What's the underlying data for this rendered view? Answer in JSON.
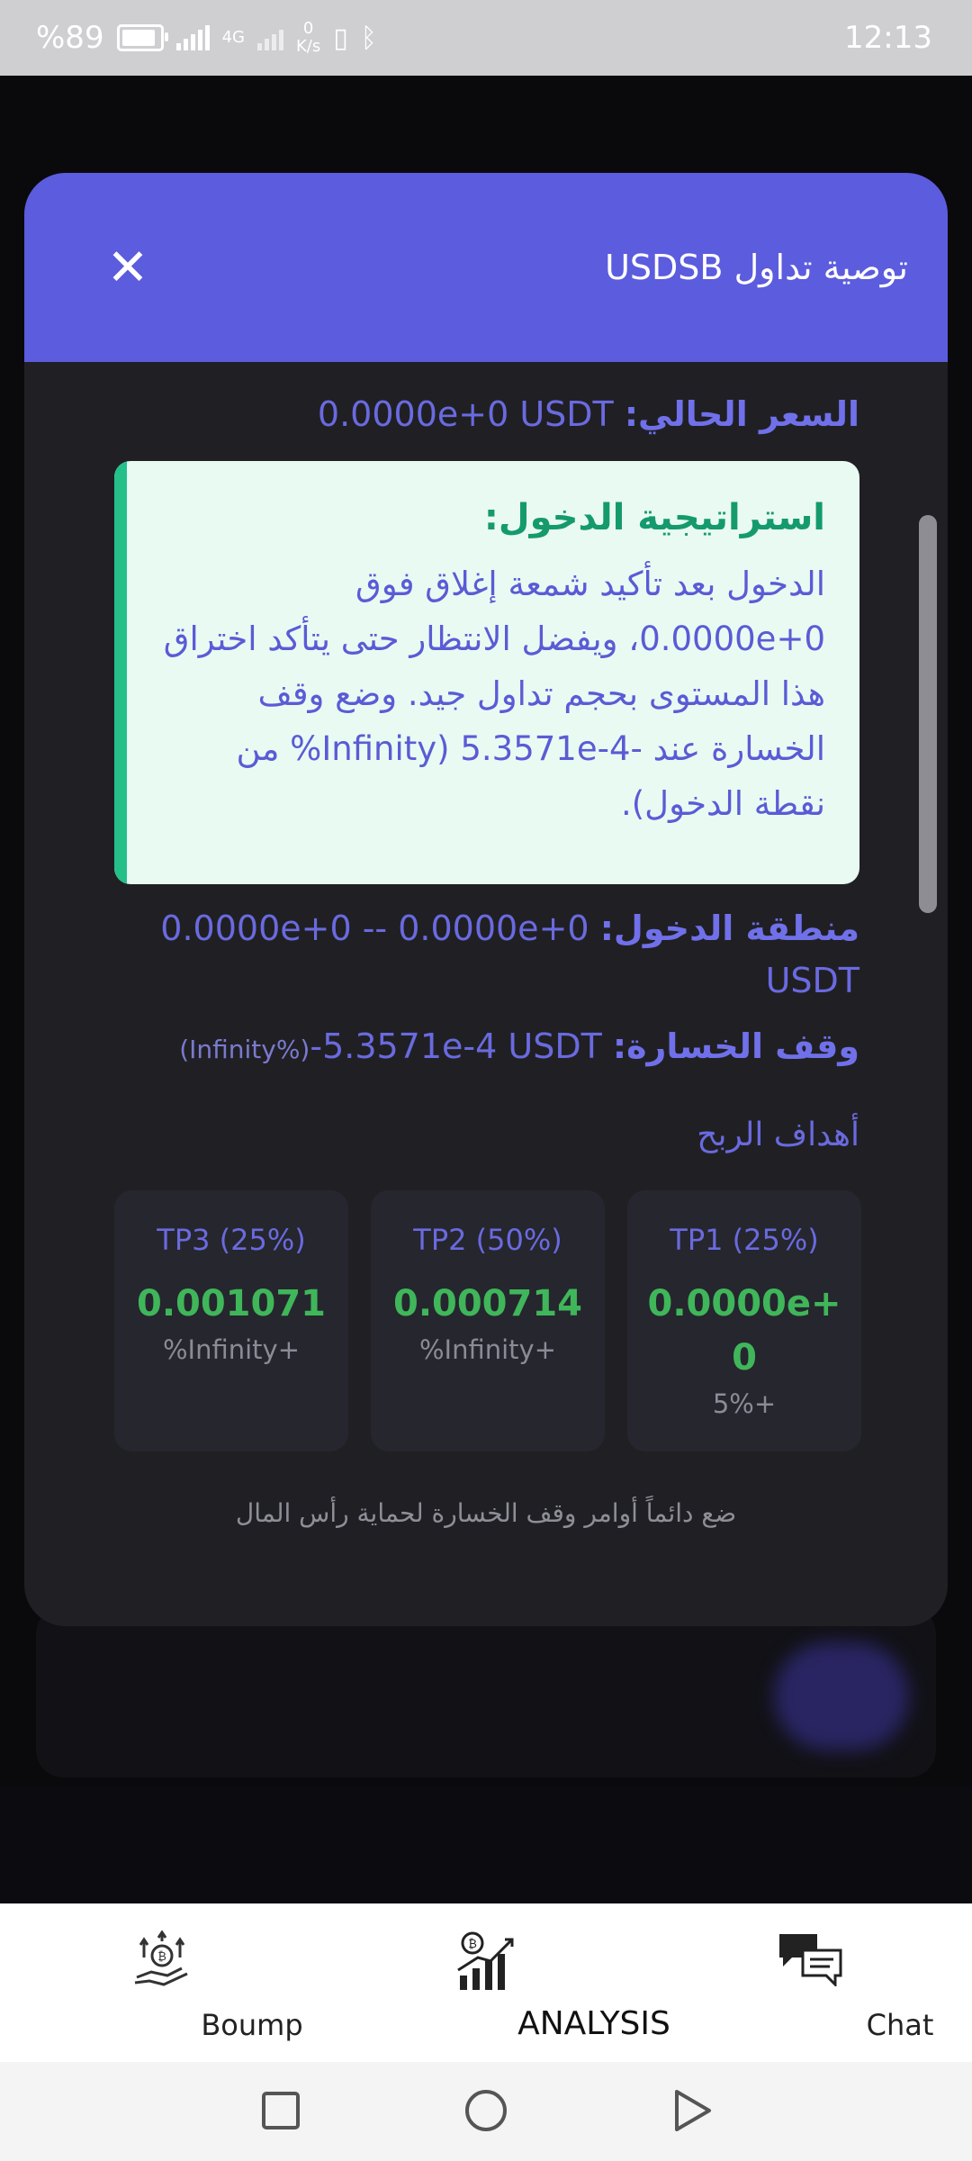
{
  "status_bar": {
    "battery_text": "%89",
    "network_type": "4G",
    "speed_value": "0",
    "speed_unit": "K/s",
    "time": "12:13"
  },
  "modal": {
    "title": "توصية تداول USDSB",
    "close_icon": "close-icon",
    "current_price_label": "السعر الحالي:",
    "current_price_value": "0.0000e+0 USDT",
    "strategy": {
      "title": "استراتيجية الدخول:",
      "body": "الدخول بعد تأكيد شمعة إغلاق فوق 0.0000e+0، ويفضل الانتظار حتى يتأكد اختراق هذا المستوى بحجم تداول جيد. وضع وقف الخسارة عند -5.3571e-4 (Infinity% من نقطة الدخول)."
    },
    "entry_zone_label": "منطقة الدخول:",
    "entry_zone_value": "0.0000e+0 -- 0.0000e+0 USDT",
    "stop_loss_label": "وقف الخسارة:",
    "stop_loss_pct": "(Infinity%)",
    "stop_loss_value": "-5.3571e-4 USDT",
    "targets_heading": "أهداف الربح",
    "targets": [
      {
        "label": "TP1 (25%)",
        "price": "0.0000e+0",
        "pct": "5%+"
      },
      {
        "label": "TP2 (50%)",
        "price": "0.000714",
        "pct": "%Infinity+"
      },
      {
        "label": "TP3 (25%)",
        "price": "0.001071",
        "pct": "%Infinity+"
      }
    ],
    "disclaimer": "ضع دائماً أوامر وقف الخسارة لحماية رأس المال"
  },
  "bottom_nav": {
    "items": [
      {
        "label": "Boump",
        "icon": "hand-coin-growth-icon"
      },
      {
        "label": "ANALYSIS",
        "icon": "bitcoin-chart-icon"
      },
      {
        "label": "Chat",
        "icon": "chat-bubbles-icon"
      }
    ]
  },
  "system_nav": {
    "recents_icon": "square-icon",
    "home_icon": "circle-icon",
    "back_icon": "triangle-icon"
  },
  "colors": {
    "header": "#5c5cde",
    "accent_text": "#6a6ae0",
    "strategy_bg": "#e9faf2",
    "strategy_bar": "#25c08a",
    "target_green": "#3fb65a"
  }
}
